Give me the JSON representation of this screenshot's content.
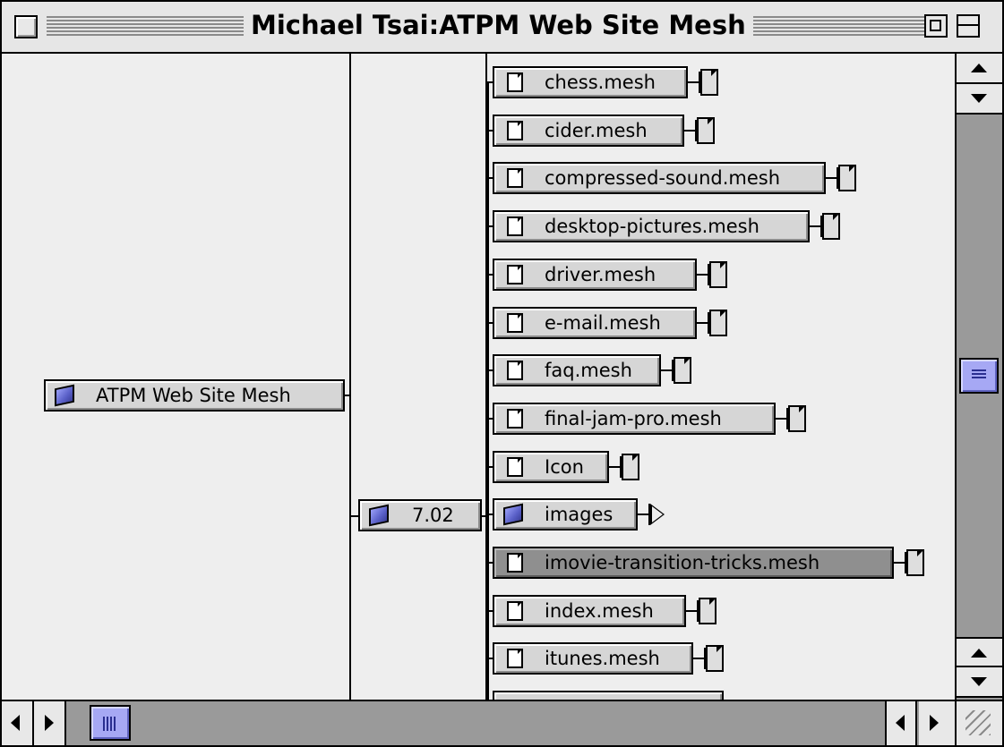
{
  "window": {
    "title": "Michael Tsai:ATPM Web Site Mesh"
  },
  "tree": {
    "root": {
      "label": "ATPM Web Site Mesh",
      "icon": "folder-icon"
    },
    "level1": {
      "label": "7.02",
      "icon": "folder-icon"
    },
    "children": [
      {
        "label": "chess.mesh",
        "icon": "document-icon",
        "selected": false
      },
      {
        "label": "cider.mesh",
        "icon": "document-icon",
        "selected": false
      },
      {
        "label": "compressed-sound.mesh",
        "icon": "document-icon",
        "selected": false
      },
      {
        "label": "desktop-pictures.mesh",
        "icon": "document-icon",
        "selected": false
      },
      {
        "label": "driver.mesh",
        "icon": "document-icon",
        "selected": false
      },
      {
        "label": "e-mail.mesh",
        "icon": "document-icon",
        "selected": false
      },
      {
        "label": "faq.mesh",
        "icon": "document-icon",
        "selected": false
      },
      {
        "label": "final-jam-pro.mesh",
        "icon": "document-icon",
        "selected": false
      },
      {
        "label": "Icon",
        "icon": "document-icon",
        "selected": false
      },
      {
        "label": "images",
        "icon": "folder-icon",
        "selected": false,
        "expandable": true
      },
      {
        "label": "imovie-transition-tricks.mesh",
        "icon": "document-icon",
        "selected": true
      },
      {
        "label": "index.mesh",
        "icon": "document-icon",
        "selected": false
      },
      {
        "label": "itunes.mesh",
        "icon": "document-icon",
        "selected": false
      }
    ]
  },
  "colors": {
    "accent": "#a6a8f4",
    "selected_node": "#8f8f8f",
    "node": "#d6d6d6"
  }
}
